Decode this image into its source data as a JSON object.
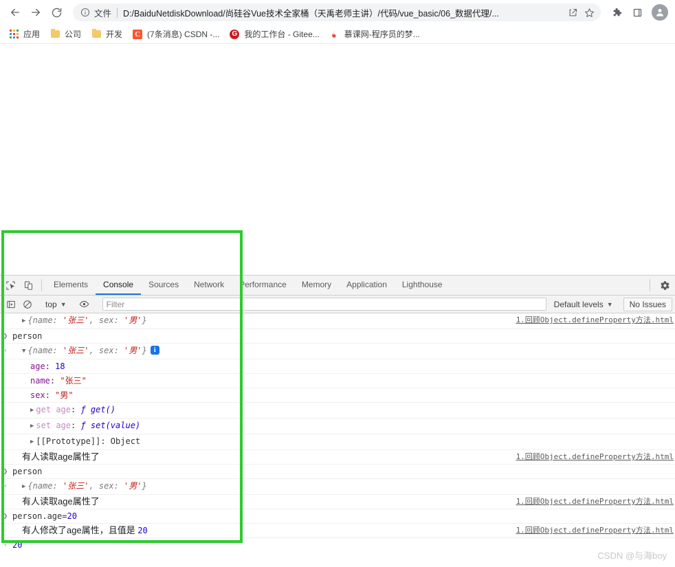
{
  "browser": {
    "nav": {
      "back_icon": "arrow-left-icon",
      "forward_icon": "arrow-right-icon",
      "reload_icon": "reload-icon"
    },
    "omnibox": {
      "info_icon": "info-circle-icon",
      "scheme_label": "文件",
      "url": "D:/BaiduNetdiskDownload/尚硅谷Vue技术全家桶（天禹老师主讲）/代码/vue_basic/06_数据代理/...",
      "share_icon": "share-icon",
      "bookmark_icon": "star-icon"
    },
    "toolbar": {
      "extensions_icon": "puzzle-piece-icon",
      "sidepanel_icon": "side-panel-icon",
      "profile_icon": "avatar-icon"
    },
    "bookmarks": [
      {
        "label": "应用",
        "icon": "apps-grid-icon"
      },
      {
        "label": "公司",
        "icon": "folder-icon"
      },
      {
        "label": "开发",
        "icon": "folder-icon"
      },
      {
        "label": "(7条消息) CSDN -...",
        "icon": "csdn-icon",
        "icon_text": "C"
      },
      {
        "label": "我的工作台 - Gitee...",
        "icon": "gitee-icon",
        "icon_text": "G"
      },
      {
        "label": "慕课网-程序员的梦...",
        "icon": "flame-icon"
      }
    ]
  },
  "devtools": {
    "left_tools": {
      "inspect_icon": "inspect-element-icon",
      "device_toolbar_icon": "device-toolbar-icon"
    },
    "tabs": [
      {
        "label": "Elements",
        "active": false
      },
      {
        "label": "Console",
        "active": true
      },
      {
        "label": "Sources",
        "active": false
      },
      {
        "label": "Network",
        "active": false
      },
      {
        "label": "Performance",
        "active": false
      },
      {
        "label": "Memory",
        "active": false
      },
      {
        "label": "Application",
        "active": false
      },
      {
        "label": "Lighthouse",
        "active": false
      }
    ],
    "settings_icon": "gear-icon",
    "filterbar": {
      "sidebar_icon": "show-console-sidebar-icon",
      "clear_icon": "clear-console-icon",
      "context": "top",
      "eye_icon": "live-expression-icon",
      "filter_value": "",
      "filter_placeholder": "Filter",
      "levels_label": "Default levels",
      "issues_label": "No Issues"
    },
    "source_link": "1.回顾Object.defineProperty方法.html",
    "console_rows": [
      {
        "kind": "output",
        "gutter": "",
        "indent": 1,
        "arrow": "▶",
        "segments": [
          {
            "cls": "obj-lit",
            "text": "{name: "
          },
          {
            "cls": "str-val",
            "text": "'张三'"
          },
          {
            "cls": "obj-lit",
            "text": ", sex: "
          },
          {
            "cls": "str-val",
            "text": "'男'"
          },
          {
            "cls": "obj-lit",
            "text": "}"
          }
        ],
        "source": "1.回顾Object.defineProperty方法.html"
      },
      {
        "kind": "input",
        "gutter": "❯",
        "indent": 0,
        "arrow": "",
        "segments": [
          {
            "cls": "proto",
            "text": "person"
          }
        ],
        "source": ""
      },
      {
        "kind": "result",
        "gutter": "‹",
        "indent": 1,
        "arrow": "▼",
        "badge": "i",
        "segments": [
          {
            "cls": "obj-lit",
            "text": "{name: "
          },
          {
            "cls": "str-val",
            "text": "'张三'"
          },
          {
            "cls": "obj-lit",
            "text": ", sex: "
          },
          {
            "cls": "str-val",
            "text": "'男'"
          },
          {
            "cls": "obj-lit",
            "text": "}"
          }
        ],
        "source": ""
      },
      {
        "kind": "prop",
        "gutter": "",
        "indent": 2,
        "arrow": "",
        "segments": [
          {
            "cls": "prop-key",
            "text": "age"
          },
          {
            "cls": "proto",
            "text": ": "
          },
          {
            "cls": "num-val",
            "text": "18"
          }
        ],
        "source": ""
      },
      {
        "kind": "prop",
        "gutter": "",
        "indent": 2,
        "arrow": "",
        "segments": [
          {
            "cls": "prop-key",
            "text": "name"
          },
          {
            "cls": "proto",
            "text": ": "
          },
          {
            "cls": "str-val2",
            "text": "\"张三\""
          }
        ],
        "source": ""
      },
      {
        "kind": "prop",
        "gutter": "",
        "indent": 2,
        "arrow": "",
        "segments": [
          {
            "cls": "prop-key",
            "text": "sex"
          },
          {
            "cls": "proto",
            "text": ": "
          },
          {
            "cls": "str-val2",
            "text": "\"男\""
          }
        ],
        "source": ""
      },
      {
        "kind": "prop",
        "gutter": "",
        "indent": 2,
        "arrow": "▶",
        "segments": [
          {
            "cls": "prop-key-accessor",
            "text": "get age"
          },
          {
            "cls": "proto",
            "text": ": "
          },
          {
            "cls": "fn-val",
            "text": "ƒ get()"
          }
        ],
        "source": ""
      },
      {
        "kind": "prop",
        "gutter": "",
        "indent": 2,
        "arrow": "▶",
        "segments": [
          {
            "cls": "prop-key-accessor",
            "text": "set age"
          },
          {
            "cls": "proto",
            "text": ": "
          },
          {
            "cls": "fn-val",
            "text": "ƒ set(value)"
          }
        ],
        "source": ""
      },
      {
        "kind": "prop",
        "gutter": "",
        "indent": 2,
        "arrow": "▶",
        "segments": [
          {
            "cls": "proto",
            "text": "[[Prototype]]: Object"
          }
        ],
        "source": ""
      },
      {
        "kind": "log",
        "gutter": "",
        "indent": 1,
        "arrow": "",
        "segments": [
          {
            "cls": "cn-text",
            "text": "有人读取age属性了"
          }
        ],
        "source": "1.回顾Object.defineProperty方法.html"
      },
      {
        "kind": "input",
        "gutter": "❯",
        "indent": 0,
        "arrow": "",
        "segments": [
          {
            "cls": "proto",
            "text": "person"
          }
        ],
        "source": ""
      },
      {
        "kind": "result",
        "gutter": "‹",
        "indent": 1,
        "arrow": "▶",
        "segments": [
          {
            "cls": "obj-lit",
            "text": "{name: "
          },
          {
            "cls": "str-val",
            "text": "'张三'"
          },
          {
            "cls": "obj-lit",
            "text": ", sex: "
          },
          {
            "cls": "str-val",
            "text": "'男'"
          },
          {
            "cls": "obj-lit",
            "text": "}"
          }
        ],
        "source": ""
      },
      {
        "kind": "log",
        "gutter": "",
        "indent": 1,
        "arrow": "",
        "segments": [
          {
            "cls": "cn-text",
            "text": "有人读取age属性了"
          }
        ],
        "source": "1.回顾Object.defineProperty方法.html"
      },
      {
        "kind": "input",
        "gutter": "❯",
        "indent": 0,
        "arrow": "",
        "segments": [
          {
            "cls": "proto",
            "text": "person.age="
          },
          {
            "cls": "num-val",
            "text": "20"
          }
        ],
        "source": ""
      },
      {
        "kind": "log",
        "gutter": "",
        "indent": 1,
        "arrow": "",
        "segments": [
          {
            "cls": "cn-text",
            "text": "有人修改了age属性，且值是 "
          },
          {
            "cls": "num-val",
            "text": "20"
          }
        ],
        "source": "1.回顾Object.defineProperty方法.html"
      },
      {
        "kind": "result",
        "gutter": "‹",
        "indent": 0,
        "arrow": "",
        "segments": [
          {
            "cls": "num-val",
            "text": "20"
          }
        ],
        "source": ""
      },
      {
        "kind": "prompt",
        "gutter": "❯",
        "indent": 0,
        "arrow": "",
        "segments": [
          {
            "cls": "proto",
            "text": ""
          }
        ],
        "source": ""
      }
    ]
  },
  "annotation": {
    "box_color": "#2ecb2e",
    "box_label": "console-highlight-box"
  },
  "watermark": {
    "text": "CSDN @与海boy"
  }
}
